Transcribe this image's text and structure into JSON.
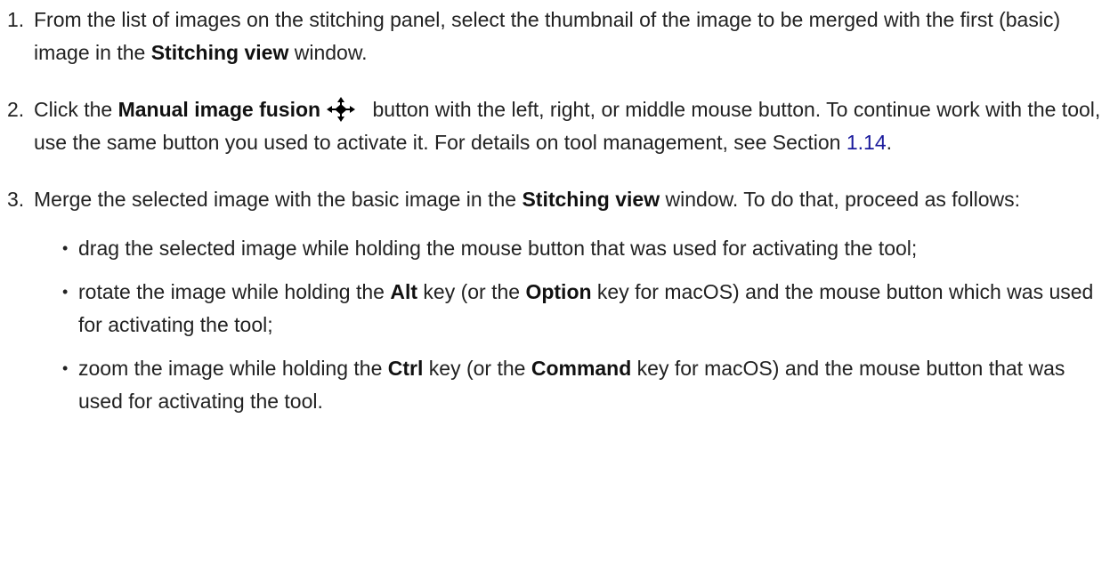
{
  "steps": [
    {
      "num": "1.",
      "t1": "From the list of images on the stitching panel, select the thumbnail of the image to be merged with the first (basic) image in the ",
      "b1": "Stitching view",
      "t2": " window."
    },
    {
      "num": "2.",
      "t1": "Click the ",
      "b1": "Manual image fusion",
      "icon": "move-arrows-icon",
      "t2": " button with the left, right, or middle mouse button. To continue work with the tool, use the same button you used to activate it. For details on tool management, see Section ",
      "link": "1.14",
      "t3": "."
    },
    {
      "num": "3.",
      "t1": "Merge the selected image with the basic image in the ",
      "b1": "Stitching view",
      "t2": " window. To do that, proceed as follows:",
      "subs": [
        {
          "t1": "drag the selected image while holding the mouse button that was used for activating the tool;"
        },
        {
          "t1": "rotate the image while holding the ",
          "b1": "Alt",
          "t2": " key (or the ",
          "b2": "Option",
          "t3": " key for macOS) and the mouse button which was used for activating the tool;"
        },
        {
          "t1": "zoom the image while holding the ",
          "b1": "Ctrl",
          "t2": " key (or the ",
          "b2": "Command",
          "t3": " key for macOS) and the mouse button that was used for activating the tool."
        }
      ]
    }
  ],
  "bullet": "•",
  "colors": {
    "text": "#222222",
    "link": "#1a1a9c"
  }
}
